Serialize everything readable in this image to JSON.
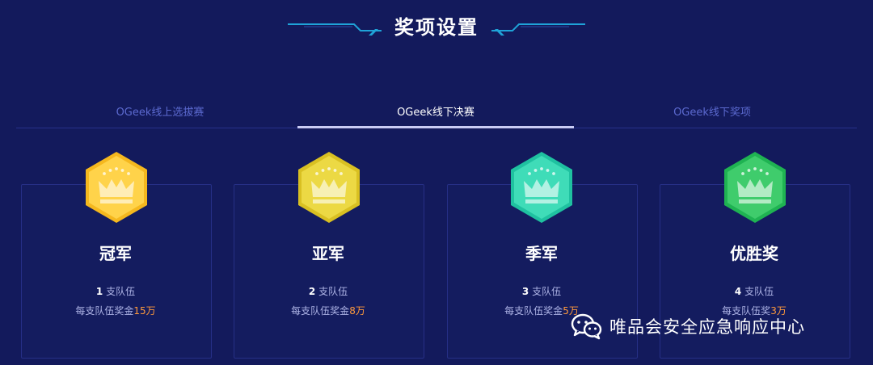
{
  "header": {
    "title": "奖项设置"
  },
  "tabs": [
    {
      "label": "OGeek线上选拔赛",
      "active": false
    },
    {
      "label": "OGeek线下决赛",
      "active": true
    },
    {
      "label": "OGeek线下奖项",
      "active": false
    }
  ],
  "prizes": [
    {
      "name": "冠军",
      "count": "1",
      "count_suffix": "支队伍",
      "bonus_prefix": "每支队伍奖金",
      "bonus_amount": "15万",
      "color": "#f5b81e",
      "color_light": "#ffd34a"
    },
    {
      "name": "亚军",
      "count": "2",
      "count_suffix": "支队伍",
      "bonus_prefix": "每支队伍奖金",
      "bonus_amount": "8万",
      "color": "#d9c022",
      "color_light": "#ecd944"
    },
    {
      "name": "季军",
      "count": "3",
      "count_suffix": "支队伍",
      "bonus_prefix": "每支队伍奖金",
      "bonus_amount": "5万",
      "color": "#1fc1a0",
      "color_light": "#3fdcb8"
    },
    {
      "name": "优胜奖",
      "count": "4",
      "count_suffix": "支队伍",
      "bonus_prefix": "每支队伍奖",
      "bonus_amount": "3万",
      "color": "#1fb352",
      "color_light": "#3fcc6c"
    }
  ],
  "watermark": {
    "text": "唯品会安全应急响应中心",
    "icon": "wechat-icon"
  },
  "colors": {
    "background": "#131a5c",
    "accent": "#ff9a3c",
    "deco": "#1fa3d8"
  }
}
